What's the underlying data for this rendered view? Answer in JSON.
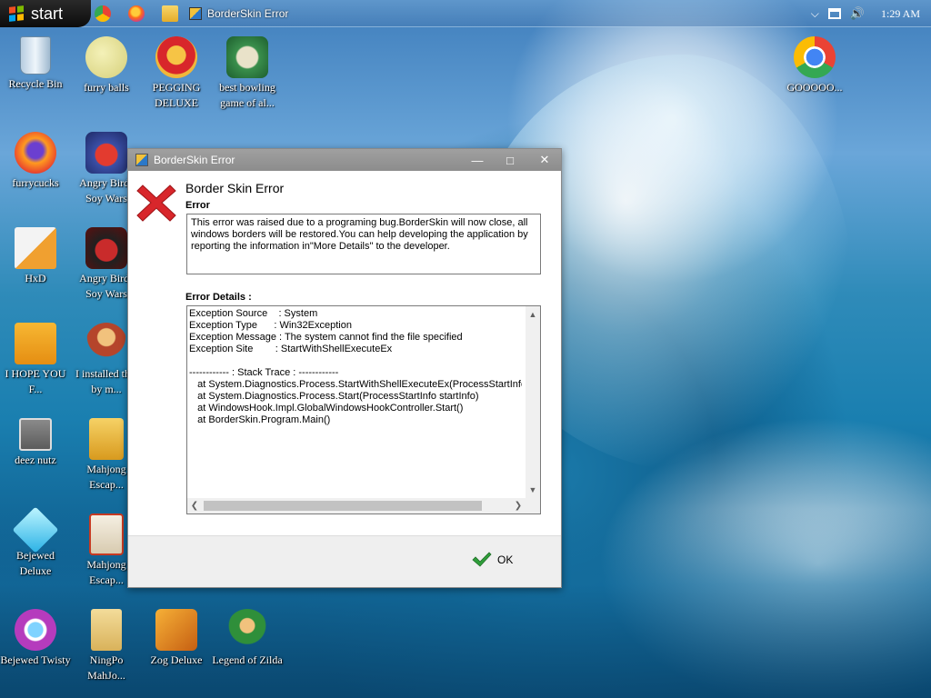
{
  "taskbar": {
    "start_label": "start",
    "active_task_title": "BorderSkin Error",
    "clock": "1:29 AM"
  },
  "desktop": {
    "icons": [
      {
        "label": "Recycle Bin"
      },
      {
        "label": "furry balls"
      },
      {
        "label": "PEGGING DELUXE"
      },
      {
        "label": "best bowling game of al..."
      },
      {
        "label": "GOOOOO..."
      },
      {
        "label": "furrycucks"
      },
      {
        "label": "Angry Birds Soy Wars"
      },
      {
        "label": "HxD"
      },
      {
        "label": "Angry Birds Soy Wars"
      },
      {
        "label": "I HOPE YOU F..."
      },
      {
        "label": "I installed this by m..."
      },
      {
        "label": "deez nutz"
      },
      {
        "label": "Mahjong Escap..."
      },
      {
        "label": "Bejewed Deluxe"
      },
      {
        "label": "Mahjong Escap..."
      },
      {
        "label": "Bejewed Twisty"
      },
      {
        "label": "NingPo MahJo..."
      },
      {
        "label": "Zog Deluxe"
      },
      {
        "label": "Legend of Zilda"
      }
    ]
  },
  "dialog": {
    "title": "BorderSkin Error",
    "heading": "Border Skin Error",
    "error_label": "Error",
    "message": "This error was raised due to a programing bug.BorderSkin will now close, all windows borders will be restored.You can help developing the application by reporting the information in\"More Details\" to the developer.",
    "details_label": "Error Details :",
    "details_text": "Exception Source    : System\nException Type      : Win32Exception\nException Message : The system cannot find the file specified\nException Site        : StartWithShellExecuteEx\n\n------------ : Stack Trace : ------------\n   at System.Diagnostics.Process.StartWithShellExecuteEx(ProcessStartInfo st\n   at System.Diagnostics.Process.Start(ProcessStartInfo startInfo)\n   at WindowsHook.Impl.GlobalWindowsHookController.Start()\n   at BorderSkin.Program.Main()",
    "ok_label": "OK"
  },
  "colors": {
    "titlebar": "#8c8c8c",
    "error_red": "#d8262b",
    "ok_green": "#2f9e3a"
  }
}
